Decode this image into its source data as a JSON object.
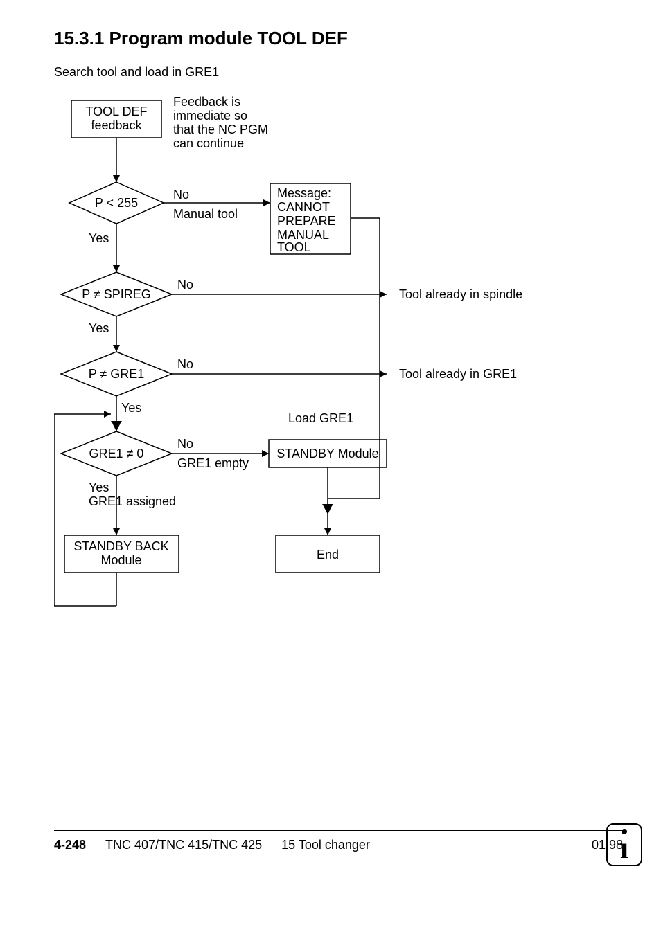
{
  "heading": "15.3.1 Program module TOOL DEF",
  "subtext": "Search tool and load in GRE1",
  "flow": {
    "n1": {
      "l1": "TOOL DEF",
      "l2": "feedback"
    },
    "n1_side": {
      "l1": "Feedback is",
      "l2": "immediate so",
      "l3": "that the NC PGM",
      "l4": "can continue"
    },
    "d1": {
      "cond": "P < 255",
      "yes": "Yes",
      "no": "No",
      "sub": "Manual tool"
    },
    "msg1": {
      "l1": "Message:",
      "l2": "CANNOT",
      "l3": "PREPARE",
      "l4": "MANUAL",
      "l5": "TOOL"
    },
    "d2": {
      "cond": "P ≠ SPIREG",
      "yes": "Yes",
      "no": "No"
    },
    "side2": "Tool already in spindle",
    "d3": {
      "cond": "P ≠ GRE1",
      "yes": "Yes",
      "no": "No",
      "label": "Load GRE1"
    },
    "side3": "Tool already in GRE1",
    "d4": {
      "cond": "GRE1 ≠ 0",
      "yes": "Yes",
      "no": "No",
      "sub_no": "GRE1 empty",
      "sub_yes": "GRE1 assigned"
    },
    "n_standby": "STANDBY Module",
    "n_stbyback": {
      "l1": "STANDBY BACK",
      "l2": "Module"
    },
    "n_end": "End"
  },
  "footer": {
    "pgnum": "4-248",
    "model": "TNC 407/TNC 415/TNC 425",
    "section": "15 Tool changer",
    "date": "01.98"
  },
  "chart_data": {
    "type": "flowchart",
    "title": "15.3.1 Program module TOOL DEF",
    "description": "Search tool and load in GRE1",
    "nodes": [
      {
        "id": "start",
        "type": "process",
        "label": "TOOL DEF feedback",
        "note": "Feedback is immediate so that the NC PGM can continue"
      },
      {
        "id": "d1",
        "type": "decision",
        "label": "P < 255"
      },
      {
        "id": "msg",
        "type": "process",
        "label": "Message: CANNOT PREPARE MANUAL TOOL"
      },
      {
        "id": "d2",
        "type": "decision",
        "label": "P ≠ SPIREG"
      },
      {
        "id": "d3",
        "type": "decision",
        "label": "P ≠ GRE1"
      },
      {
        "id": "d4",
        "type": "decision",
        "label": "GRE1 ≠ 0"
      },
      {
        "id": "standby",
        "type": "process",
        "label": "STANDBY Module",
        "note": "Load GRE1"
      },
      {
        "id": "stbyback",
        "type": "process",
        "label": "STANDBY BACK Module"
      },
      {
        "id": "end",
        "type": "terminator",
        "label": "End"
      }
    ],
    "edges": [
      {
        "from": "start",
        "to": "d1"
      },
      {
        "from": "d1",
        "to": "msg",
        "label": "No — Manual tool"
      },
      {
        "from": "d1",
        "to": "d2",
        "label": "Yes"
      },
      {
        "from": "msg",
        "to": "end"
      },
      {
        "from": "d2",
        "to": "end",
        "label": "No — Tool already in spindle"
      },
      {
        "from": "d2",
        "to": "d3",
        "label": "Yes"
      },
      {
        "from": "d3",
        "to": "end",
        "label": "No — Tool already in GRE1"
      },
      {
        "from": "d3",
        "to": "d4",
        "label": "Yes"
      },
      {
        "from": "d4",
        "to": "standby",
        "label": "No — GRE1 empty"
      },
      {
        "from": "d4",
        "to": "stbyback",
        "label": "Yes — GRE1 assigned"
      },
      {
        "from": "standby",
        "to": "end"
      },
      {
        "from": "stbyback",
        "to": "d4",
        "label": "loop back"
      }
    ]
  }
}
